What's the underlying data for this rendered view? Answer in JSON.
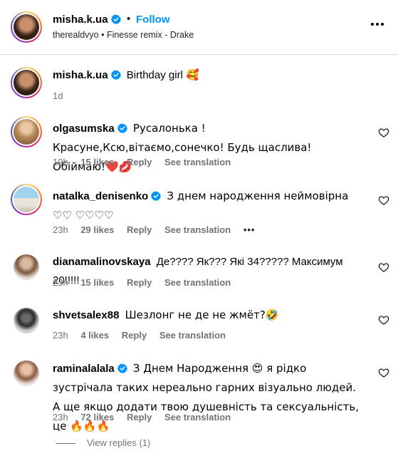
{
  "post": {
    "author": "misha.k.ua",
    "dot": "•",
    "follow_label": "Follow",
    "audio_line": "therealdvyo • Finesse remix - Drake",
    "caption": "Birthday girl 🥰",
    "caption_time": "1d",
    "more_icon": "more-horizontal-icon"
  },
  "comments": [
    {
      "username": "olgasumska",
      "verified": true,
      "text": "Русалонька !Красуне,Ксю,вітаємо,сонечко! Будь щаслива!Обіймаю!❤️💋",
      "time": "19h",
      "likes": "15 likes",
      "reply": "Reply",
      "translation": "See translation"
    },
    {
      "username": "natalka_denisenko",
      "verified": true,
      "text": "З днем народження неймовірна ♡♡ ♡♡♡♡",
      "time": "23h",
      "likes": "29 likes",
      "reply": "Reply",
      "translation": "See translation",
      "more": "•••"
    },
    {
      "username": "dianamalinovskaya",
      "verified": false,
      "text": "Де???? Як??? Які 34????? Максимум 20!!!!!",
      "time": "23h",
      "likes": "15 likes",
      "reply": "Reply",
      "translation": "See translation"
    },
    {
      "username": "shvetsalex88",
      "verified": false,
      "text": "Шезлонг не де не жмёт?🤣",
      "time": "23h",
      "likes": "4 likes",
      "reply": "Reply",
      "translation": "See translation"
    },
    {
      "username": "raminalalala",
      "verified": true,
      "text": "З Днем Народження 😍 я рідко зустрічала таких нереально гарних візуально людей. А ще якщо додати твою душевність та сексуальність, це 🔥🔥🔥",
      "time": "23h",
      "likes": "72 likes",
      "reply": "Reply",
      "translation": "See translation"
    }
  ],
  "view_replies": "View replies (1)",
  "colors": {
    "accent": "#0095f6",
    "verified": "#0095f6",
    "muted": "#737373",
    "divider": "#dbdbdb"
  }
}
